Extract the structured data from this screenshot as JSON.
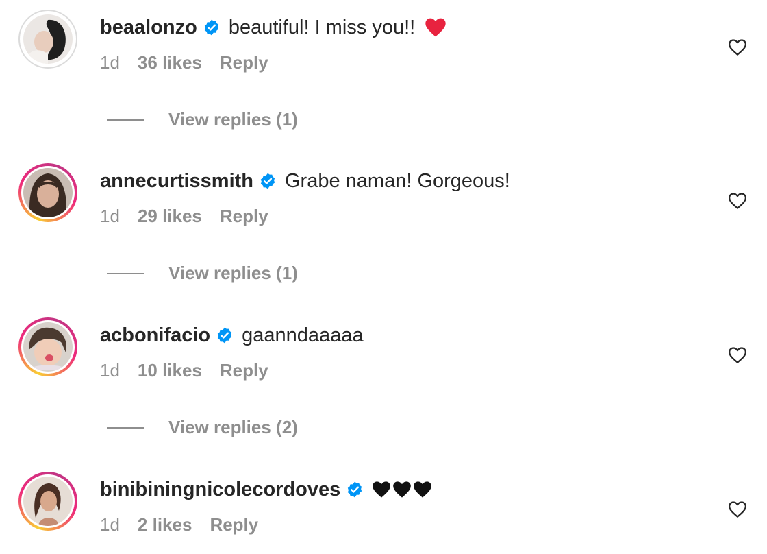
{
  "comments": [
    {
      "username": "beaalonzo",
      "text": "beautiful! I miss you!!",
      "time": "1d",
      "likes": "36 likes",
      "reply_label": "Reply",
      "view_replies": "View replies (1)",
      "avatar_ring": "seen",
      "has_heart": true
    },
    {
      "username": "annecurtissmith",
      "text": "Grabe naman! Gorgeous!",
      "time": "1d",
      "likes": "29 likes",
      "reply_label": "Reply",
      "view_replies": "View replies (1)",
      "avatar_ring": "story"
    },
    {
      "username": "acbonifacio",
      "text": "gaanndaaaaa",
      "time": "1d",
      "likes": "10 likes",
      "reply_label": "Reply",
      "view_replies": "View replies (2)",
      "avatar_ring": "story"
    },
    {
      "username": "binibiningnicolecordoves",
      "text": "",
      "time": "1d",
      "likes": "2 likes",
      "reply_label": "Reply",
      "avatar_ring": "story",
      "black_hearts": 3
    }
  ],
  "icons": {
    "verified": "verified-badge-icon",
    "like": "heart-outline-icon",
    "red_heart": "red-heart-emoji",
    "black_heart": "black-heart-emoji"
  },
  "colors": {
    "verified_blue": "#0095f6",
    "muted_text": "#8e8e8e",
    "primary_text": "#262626",
    "red_heart": "#e8233f"
  }
}
